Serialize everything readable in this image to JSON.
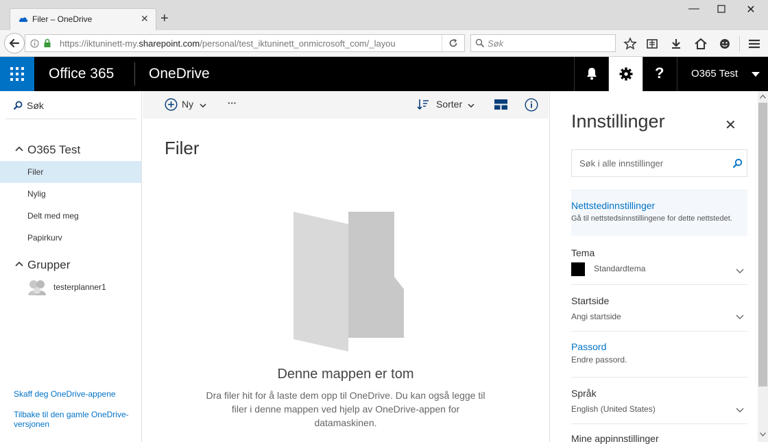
{
  "browser": {
    "tab_title": "Filer – OneDrive",
    "url_prefix": "https://iktuninett-my.",
    "url_domain": "sharepoint.com",
    "url_suffix": "/personal/test_iktuninett_onmicrosoft_com/_layou",
    "search_placeholder": "Søk"
  },
  "header": {
    "suite_title": "Office 365",
    "app_title": "OneDrive",
    "user_name": "O365 Test"
  },
  "leftnav": {
    "search_label": "Søk",
    "group_user": "O365 Test",
    "items": [
      {
        "label": "Filer"
      },
      {
        "label": "Nylig"
      },
      {
        "label": "Delt med meg"
      },
      {
        "label": "Papirkurv"
      }
    ],
    "group_groups": "Grupper",
    "group_item": "testerplanner1",
    "link_apps": "Skaff deg OneDrive-appene",
    "link_old": "Tilbake til den gamle OneDrive-versjonen"
  },
  "commandbar": {
    "new_label": "Ny",
    "more_label": "···",
    "sort_label": "Sorter"
  },
  "main": {
    "page_title": "Filer",
    "empty_title": "Denne mappen er tom",
    "empty_desc": "Dra filer hit for å laste dem opp til OneDrive. Du kan også legge til filer i denne mappen ved hjelp av OneDrive-appen for datamaskinen."
  },
  "settings": {
    "title": "Innstillinger",
    "search_placeholder": "Søk i alle innstillinger",
    "site_settings": {
      "title": "Nettstedinnstillinger",
      "desc": "Gå til nettstedsinnstillingene for dette nettstedet."
    },
    "theme": {
      "title": "Tema",
      "value": "Standardtema"
    },
    "start_page": {
      "title": "Startside",
      "value": "Angi startside"
    },
    "password": {
      "title": "Passord",
      "desc": "Endre passord."
    },
    "language": {
      "title": "Språk",
      "value": "English (United States)"
    },
    "app_settings": {
      "title": "Mine appinnstillinger"
    }
  },
  "colors": {
    "accent": "#0072c6",
    "header_bg": "#000000",
    "selected_nav": "#d9eaf7"
  }
}
